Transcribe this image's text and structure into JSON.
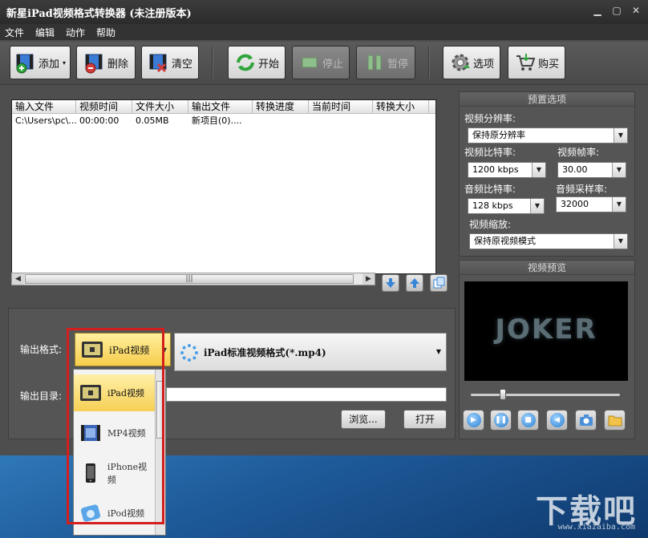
{
  "window": {
    "title": "新星iPad视频格式转换器 (未注册版本)"
  },
  "menu": [
    "文件",
    "编辑",
    "动作",
    "帮助"
  ],
  "toolbar": {
    "add": "添加",
    "delete": "删除",
    "clear": "清空",
    "start": "开始",
    "stop": "停止",
    "pause": "暂停",
    "options": "选项",
    "buy": "购买"
  },
  "filelist": {
    "columns": [
      "输入文件",
      "视频时间",
      "文件大小",
      "输出文件",
      "转换进度",
      "当前时间",
      "转换大小"
    ],
    "rows": [
      [
        "C:\\Users\\pc\\...",
        "00:00:00",
        "0.05MB",
        "新项目(0)....",
        "",
        "",
        ""
      ]
    ]
  },
  "preset": {
    "title": "预置选项",
    "resolution_label": "视频分辨率:",
    "resolution_value": "保持原分辨率",
    "vbitrate_label": "视频比特率:",
    "vbitrate_value": "1200 kbps",
    "framerate_label": "视频帧率:",
    "framerate_value": "30.00",
    "abitrate_label": "音频比特率:",
    "abitrate_value": "128 kbps",
    "samplerate_label": "音频采样率:",
    "samplerate_value": "32000",
    "scale_label": "视频缩放:",
    "scale_value": "保持原视频模式"
  },
  "preview": {
    "title": "视频预览",
    "frame_text": "JOKER"
  },
  "output": {
    "format_label": "输出格式:",
    "format_value": "iPad视频",
    "profile_value": "iPad标准视频格式(*.mp4)",
    "dir_label": "输出目录:",
    "dir_value": "",
    "browse": "浏览...",
    "open": "打开"
  },
  "format_dropdown": [
    "iPad视频",
    "MP4视频",
    "iPhone视频",
    "iPod视频"
  ],
  "watermark": {
    "text": "下载吧",
    "sub": "www.xiazaiba.com"
  },
  "colors": {
    "highlight": "#d41e1e",
    "selected": "#f6cf55",
    "panel": "#555555"
  }
}
